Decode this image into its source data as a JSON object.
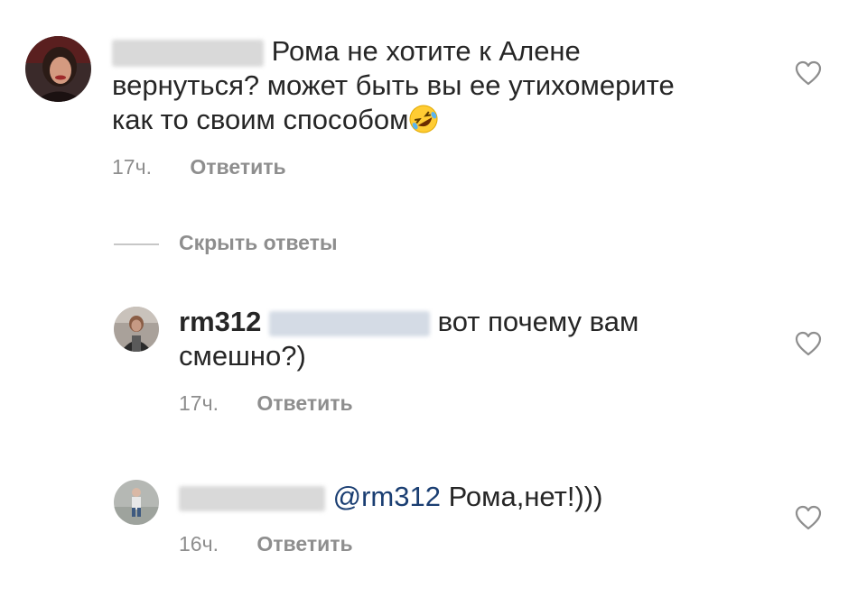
{
  "comments": [
    {
      "username_hidden": "vikulya120",
      "text_line1": "Рома не хотите к Алене",
      "text_line2": "вернуться? может быть вы ее утихомерите",
      "text_line3": "как то своим способом",
      "emoji": "rolling-on-floor-laughing-emoji",
      "time": "17ч.",
      "reply_label": "Ответить"
    }
  ],
  "hide_replies_label": "Скрыть ответы",
  "replies": [
    {
      "username": "rm312",
      "mention_hidden": "@vikulya120",
      "text_line1": "вот почему вам",
      "text_line2": "смешно?)",
      "time": "17ч.",
      "reply_label": "Ответить"
    },
    {
      "username_hidden": "alla280178",
      "mention": "@rm312",
      "text": "Рома,нет!)))",
      "time": "16ч.",
      "reply_label": "Ответить"
    }
  ],
  "colors": {
    "text": "#262626",
    "secondary": "#8e8e8e",
    "mention": "#1a3e72",
    "heart": "#8e8e8e"
  },
  "icons": [
    "heart-icon",
    "avatar"
  ]
}
